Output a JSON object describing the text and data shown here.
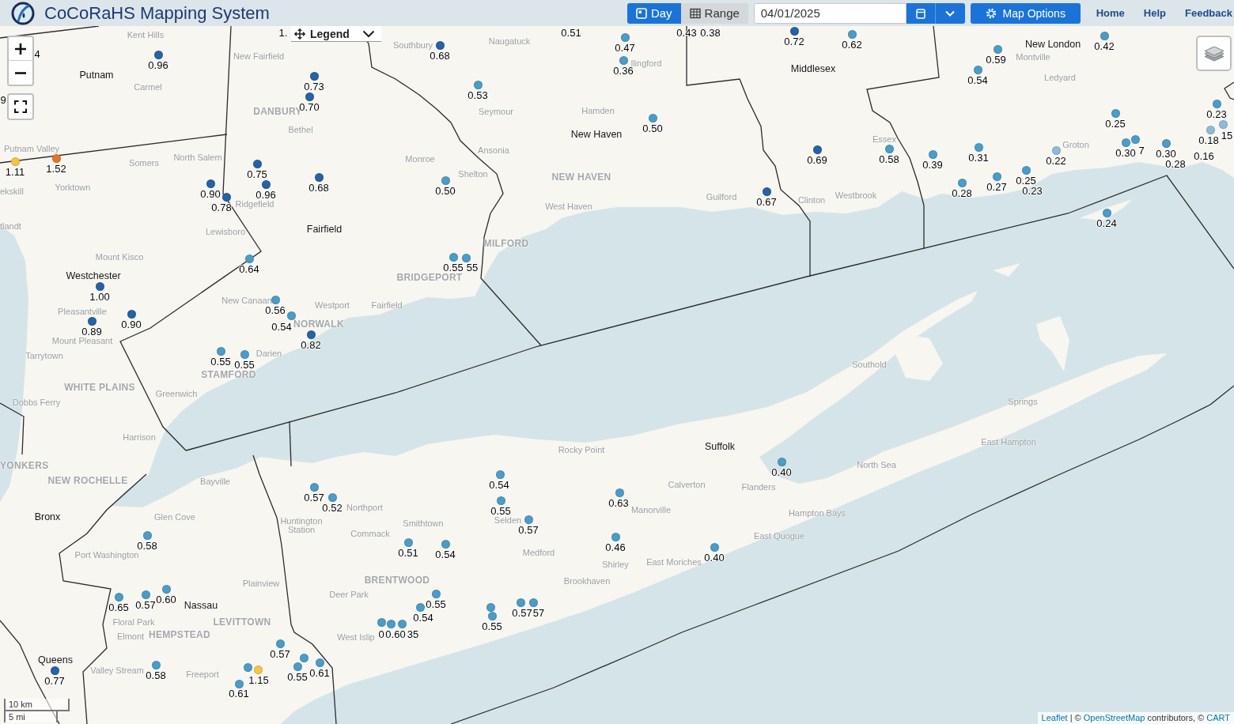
{
  "header": {
    "title": "CoCoRaHS Mapping System",
    "view_tabs": [
      {
        "label": "Day",
        "selected": true
      },
      {
        "label": "Range",
        "selected": false
      }
    ],
    "date_field": {
      "value": "04/01/2025"
    },
    "map_options_button": "Map Options",
    "nav_links": [
      "Home",
      "Help",
      "Feedback"
    ]
  },
  "map": {
    "legend_button": "Legend",
    "place_labels": [
      {
        "text": "Kent Hills",
        "kind": "town"
      },
      {
        "text": "Southbury",
        "kind": "town"
      },
      {
        "text": "Naugatuck",
        "kind": "town"
      },
      {
        "text": "New London",
        "kind": "county"
      },
      {
        "text": "New Fairfield",
        "kind": "town"
      },
      {
        "text": "Montville",
        "kind": "town"
      },
      {
        "text": "llingford",
        "kind": "town"
      },
      {
        "text": "Putnam",
        "kind": "county"
      },
      {
        "text": "Middlesex",
        "kind": "county"
      },
      {
        "text": "Ledyard",
        "kind": "town"
      },
      {
        "text": "Carmel",
        "kind": "town"
      },
      {
        "text": "DANBURY",
        "kind": "city"
      },
      {
        "text": "Seymour",
        "kind": "town"
      },
      {
        "text": "Hamden",
        "kind": "town"
      },
      {
        "text": "Bethel",
        "kind": "town"
      },
      {
        "text": "New Haven",
        "kind": "county"
      },
      {
        "text": "Essex",
        "kind": "town"
      },
      {
        "text": "Putnam Valley",
        "kind": "town"
      },
      {
        "text": "Ansonia",
        "kind": "town"
      },
      {
        "text": "Groton",
        "kind": "town"
      },
      {
        "text": "Somers",
        "kind": "town"
      },
      {
        "text": "North Salem",
        "kind": "town"
      },
      {
        "text": "Monroe",
        "kind": "town"
      },
      {
        "text": "Shelton",
        "kind": "town"
      },
      {
        "text": "NEW HAVEN",
        "kind": "city"
      },
      {
        "text": "ekskill",
        "kind": "town"
      },
      {
        "text": "Yorktown",
        "kind": "town"
      },
      {
        "text": "Ridgefield",
        "kind": "town"
      },
      {
        "text": "West Haven",
        "kind": "town"
      },
      {
        "text": "Guilford",
        "kind": "town"
      },
      {
        "text": "Clinton",
        "kind": "town"
      },
      {
        "text": "Westbrook",
        "kind": "town"
      },
      {
        "text": "tlandt",
        "kind": "town"
      },
      {
        "text": "Lewisboro",
        "kind": "town"
      },
      {
        "text": "Fairfield",
        "kind": "county"
      },
      {
        "text": "MILFORD",
        "kind": "city"
      },
      {
        "text": "Mount Kisco",
        "kind": "town"
      },
      {
        "text": "Westchester",
        "kind": "county"
      },
      {
        "text": "BRIDGEPORT",
        "kind": "city"
      },
      {
        "text": "Pleasantville",
        "kind": "town"
      },
      {
        "text": "New Canaan",
        "kind": "town"
      },
      {
        "text": "Westport",
        "kind": "town"
      },
      {
        "text": "Fairfield",
        "kind": "town"
      },
      {
        "text": "NORWALK",
        "kind": "city"
      },
      {
        "text": "Mount Pleasant",
        "kind": "town"
      },
      {
        "text": "Tarrytown",
        "kind": "town"
      },
      {
        "text": "Darien",
        "kind": "town"
      },
      {
        "text": "Southold",
        "kind": "town"
      },
      {
        "text": "STAMFORD",
        "kind": "city"
      },
      {
        "text": "WHITE PLAINS",
        "kind": "city"
      },
      {
        "text": "Greenwich",
        "kind": "town"
      },
      {
        "text": "Dobbs Ferry",
        "kind": "town"
      },
      {
        "text": "Springs",
        "kind": "town"
      },
      {
        "text": "Harrison",
        "kind": "town"
      },
      {
        "text": "Rocky Point",
        "kind": "town"
      },
      {
        "text": "Suffolk",
        "kind": "county"
      },
      {
        "text": "East Hampton",
        "kind": "town"
      },
      {
        "text": "YONKERS",
        "kind": "city"
      },
      {
        "text": "North Sea",
        "kind": "town"
      },
      {
        "text": "NEW ROCHELLE",
        "kind": "city"
      },
      {
        "text": "Bayville",
        "kind": "town"
      },
      {
        "text": "Calverton",
        "kind": "town"
      },
      {
        "text": "Flanders",
        "kind": "town"
      },
      {
        "text": "Bronx",
        "kind": "county"
      },
      {
        "text": "Glen Cove",
        "kind": "town"
      },
      {
        "text": "Huntington Station",
        "kind": "town"
      },
      {
        "text": "Northport",
        "kind": "town"
      },
      {
        "text": "Smithtown",
        "kind": "town"
      },
      {
        "text": "Selden",
        "kind": "town"
      },
      {
        "text": "Manorville",
        "kind": "town"
      },
      {
        "text": "Hampton Bays",
        "kind": "town"
      },
      {
        "text": "Commack",
        "kind": "town"
      },
      {
        "text": "East Quogue",
        "kind": "town"
      },
      {
        "text": "Port Washington",
        "kind": "town"
      },
      {
        "text": "Medford",
        "kind": "town"
      },
      {
        "text": "Shirley",
        "kind": "town"
      },
      {
        "text": "East Moriches",
        "kind": "town"
      },
      {
        "text": "Plainview",
        "kind": "town"
      },
      {
        "text": "BRENTWOOD",
        "kind": "city"
      },
      {
        "text": "Brookhaven",
        "kind": "town"
      },
      {
        "text": "Deer Park",
        "kind": "town"
      },
      {
        "text": "Nassau",
        "kind": "county"
      },
      {
        "text": "Floral Park",
        "kind": "town"
      },
      {
        "text": "LEVITTOWN",
        "kind": "city"
      },
      {
        "text": "Elmont",
        "kind": "town"
      },
      {
        "text": "HEMPSTEAD",
        "kind": "city"
      },
      {
        "text": "West Islip",
        "kind": "town"
      },
      {
        "text": "Queens",
        "kind": "county"
      },
      {
        "text": "Valley Stream",
        "kind": "town"
      },
      {
        "text": "Freeport",
        "kind": "town"
      }
    ],
    "stations": [
      {
        "value": "1."
      },
      {
        "value": "0.51"
      },
      {
        "value": "0.43"
      },
      {
        "value": "0.38"
      },
      {
        "value": "0.47",
        "color": "#4b9cc8"
      },
      {
        "value": "0.72",
        "color": "#2562a6"
      },
      {
        "value": "0.62",
        "color": "#4b9cc8"
      },
      {
        "value": "0.42",
        "color": "#4b9cc8"
      },
      {
        "value": "4"
      },
      {
        "value": "0.96",
        "color": "#2562a6"
      },
      {
        "value": "0.68",
        "color": "#2562a6"
      },
      {
        "value": "0.59",
        "color": "#4b9cc8"
      },
      {
        "value": "0.36",
        "color": "#4b9cc8"
      },
      {
        "value": "0.54",
        "color": "#4b9cc8"
      },
      {
        "value": "0.73",
        "color": "#2562a6"
      },
      {
        "value": "0.53",
        "color": "#4b9cc8"
      },
      {
        "value": "9"
      },
      {
        "value": "0.70",
        "color": "#2562a6"
      },
      {
        "value": "0.23",
        "color": "#4b9cc8"
      },
      {
        "value": "0.25",
        "color": "#4b9cc8"
      },
      {
        "value": "0.50",
        "color": "#4b9cc8"
      },
      {
        "value": "15",
        "color": "#8dbbd9"
      },
      {
        "value": "0.18",
        "color": "#8dbbd9"
      },
      {
        "value": "0.69",
        "color": "#2562a6"
      },
      {
        "value": "0.58",
        "color": "#4b9cc8"
      },
      {
        "value": "0.39",
        "color": "#4b9cc8"
      },
      {
        "value": "0.31",
        "color": "#4b9cc8"
      },
      {
        "value": "0.22",
        "color": "#8dbbd9"
      },
      {
        "value": "0.30",
        "color": "#4b9cc8"
      },
      {
        "value": "7",
        "color": "#4b9cc8"
      },
      {
        "value": "0.30",
        "color": "#4b9cc8"
      },
      {
        "value": "0.28"
      },
      {
        "value": "0.16"
      },
      {
        "value": "1.11",
        "color": "#f6c443"
      },
      {
        "value": "1.52",
        "color": "#e8732b"
      },
      {
        "value": "0.75",
        "color": "#2562a6"
      },
      {
        "value": "0.25",
        "color": "#4b9cc8"
      },
      {
        "value": "0.90",
        "color": "#2562a6"
      },
      {
        "value": "0.96",
        "color": "#2562a6"
      },
      {
        "value": "0.68",
        "color": "#2562a6"
      },
      {
        "value": "0.50",
        "color": "#4b9cc8"
      },
      {
        "value": "0.28",
        "color": "#4b9cc8"
      },
      {
        "value": "0.27",
        "color": "#4b9cc8"
      },
      {
        "value": "0.23"
      },
      {
        "value": "0.78",
        "color": "#2562a6"
      },
      {
        "value": "0.67",
        "color": "#2562a6"
      },
      {
        "value": "0.24",
        "color": "#4b9cc8"
      },
      {
        "value": "0.64",
        "color": "#4b9cc8"
      },
      {
        "value": "0.55",
        "color": "#4b9cc8"
      },
      {
        "value": "55",
        "color": "#4b9cc8"
      },
      {
        "value": "1.00",
        "color": "#2562a6"
      },
      {
        "value": "0.56",
        "color": "#4b9cc8"
      },
      {
        "value": "0.89",
        "color": "#2562a6"
      },
      {
        "value": "0.90",
        "color": "#2562a6"
      },
      {
        "value": "0.54",
        "color": "#4b9cc8"
      },
      {
        "value": "0.82",
        "color": "#2562a6"
      },
      {
        "value": "0.55",
        "color": "#4b9cc8"
      },
      {
        "value": "0.55",
        "color": "#4b9cc8"
      },
      {
        "value": "0.40",
        "color": "#4b9cc8"
      },
      {
        "value": "0.54",
        "color": "#4b9cc8"
      },
      {
        "value": "0.57",
        "color": "#4b9cc8"
      },
      {
        "value": "0.52",
        "color": "#4b9cc8"
      },
      {
        "value": "0.55",
        "color": "#4b9cc8"
      },
      {
        "value": "0.63",
        "color": "#4b9cc8"
      },
      {
        "value": "0.57",
        "color": "#4b9cc8"
      },
      {
        "value": "0.58",
        "color": "#4b9cc8"
      },
      {
        "value": "0.51",
        "color": "#4b9cc8"
      },
      {
        "value": "0.54",
        "color": "#4b9cc8"
      },
      {
        "value": "0.46",
        "color": "#4b9cc8"
      },
      {
        "value": "0.40",
        "color": "#4b9cc8"
      },
      {
        "value": "0.65",
        "color": "#4b9cc8"
      },
      {
        "value": "0.57",
        "color": "#4b9cc8"
      },
      {
        "value": "0.60",
        "color": "#4b9cc8"
      },
      {
        "value": "0.54",
        "color": "#4b9cc8"
      },
      {
        "value": "0.55",
        "color": "#4b9cc8"
      },
      {
        "color": "#4b9cc8"
      },
      {
        "value": "0.57",
        "color": "#4b9cc8"
      },
      {
        "value": "57",
        "color": "#4b9cc8"
      },
      {
        "value": "0.55",
        "color": "#4b9cc8"
      },
      {
        "value": "0",
        "color": "#4b9cc8"
      },
      {
        "value": "0.60",
        "color": "#4b9cc8"
      },
      {
        "value": "35",
        "color": "#4b9cc8"
      },
      {
        "value": "0.57",
        "color": "#4b9cc8"
      },
      {
        "value": "0.77",
        "color": "#2562a6"
      },
      {
        "value": "0.58",
        "color": "#4b9cc8"
      },
      {
        "color": "#4b9cc8"
      },
      {
        "value": "1.15",
        "color": "#f6c443"
      },
      {
        "value": "0.55",
        "color": "#4b9cc8"
      },
      {
        "color": "#4b9cc8"
      },
      {
        "value": "0.61",
        "color": "#4b9cc8"
      },
      {
        "value": "0.61",
        "color": "#4b9cc8"
      }
    ],
    "scale": [
      "10 km",
      "5 mi"
    ],
    "attribution": [
      {
        "text": "Leaflet",
        "kind": "link"
      },
      {
        "text": " | © ",
        "kind": "text"
      },
      {
        "text": "OpenStreetMap",
        "kind": "link"
      },
      {
        "text": " contributors, © ",
        "kind": "text"
      },
      {
        "text": "CART",
        "kind": "link"
      }
    ]
  }
}
